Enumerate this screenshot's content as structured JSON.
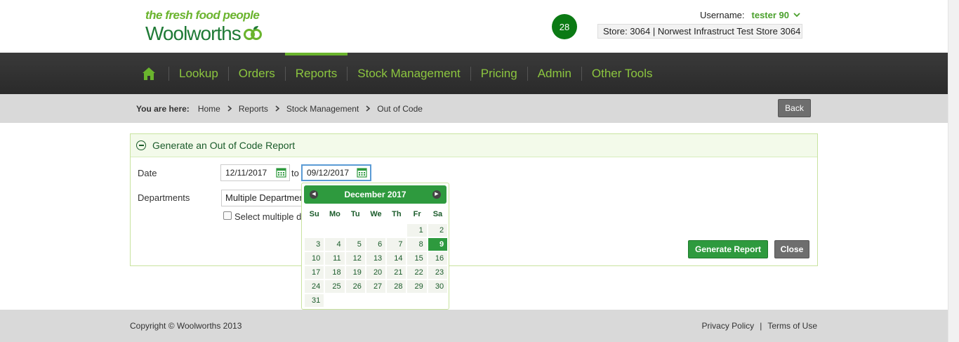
{
  "header": {
    "tagline": "the fresh food people",
    "brand": "Woolworths",
    "notification_count": "28",
    "username_label": "Username:",
    "username": "tester 90",
    "store": "Store: 3064 | Norwest Infrastruct Test Store 3064"
  },
  "nav": {
    "items": [
      {
        "label": "Lookup"
      },
      {
        "label": "Orders"
      },
      {
        "label": "Reports"
      },
      {
        "label": "Stock Management"
      },
      {
        "label": "Pricing"
      },
      {
        "label": "Admin"
      },
      {
        "label": "Other Tools"
      }
    ],
    "active": "Reports"
  },
  "breadcrumb": {
    "lead": "You are here:",
    "items": [
      "Home",
      "Reports",
      "Stock Management",
      "Out of Code"
    ],
    "back_label": "Back"
  },
  "panel": {
    "title": "Generate an Out of Code Report",
    "date_label": "Date",
    "date_from": "12/11/2017",
    "to_label": "to",
    "date_to": "09/12/2017",
    "departments_label": "Departments",
    "departments_value": "Multiple Departments",
    "select_multiple_label": "Select multiple departments",
    "generate_label": "Generate Report",
    "close_label": "Close"
  },
  "calendar": {
    "month_label": "December 2017",
    "weekdays": [
      "Su",
      "Mo",
      "Tu",
      "We",
      "Th",
      "Fr",
      "Sa"
    ],
    "leading_blanks": 5,
    "days": [
      "1",
      "2",
      "3",
      "4",
      "5",
      "6",
      "7",
      "8",
      "9",
      "10",
      "11",
      "12",
      "13",
      "14",
      "15",
      "16",
      "17",
      "18",
      "19",
      "20",
      "21",
      "22",
      "23",
      "24",
      "25",
      "26",
      "27",
      "28",
      "29",
      "30",
      "31"
    ],
    "selected": "9"
  },
  "footer": {
    "copyright": "Copyright © Woolworths 2013",
    "privacy": "Privacy Policy",
    "separator": "|",
    "terms": "Terms of Use"
  },
  "colors": {
    "brand_green": "#2e9a3e",
    "nav_text": "#8cc63f",
    "nav_bg": "#2f2f2f"
  }
}
